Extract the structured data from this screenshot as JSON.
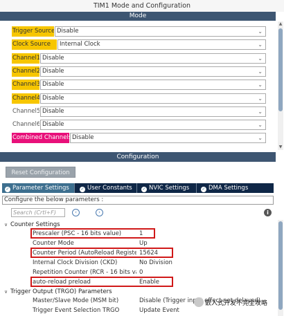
{
  "window": {
    "title": "TIM1 Mode and Configuration"
  },
  "mode_header": "Mode",
  "mode_rows": [
    {
      "label": "Trigger Source",
      "value": "Disable",
      "highlight": "#f7c600"
    },
    {
      "label": "Clock Source",
      "value": "Internal Clock",
      "highlight": "#f7c600"
    },
    {
      "label": "Channel1",
      "value": "Disable",
      "highlight": "#f7c600"
    },
    {
      "label": "Channel2",
      "value": "Disable",
      "highlight": "#f7c600"
    },
    {
      "label": "Channel3",
      "value": "Disable",
      "highlight": "#f7c600"
    },
    {
      "label": "Channel4",
      "value": "Disable",
      "highlight": "#f7c600"
    },
    {
      "label": "Channel5",
      "value": "Disable",
      "highlight": ""
    },
    {
      "label": "Channel6",
      "value": "Disable",
      "highlight": ""
    },
    {
      "label": "Combined Channels",
      "value": "Disable",
      "highlight": "#e8107a"
    }
  ],
  "config_header": "Configuration",
  "reset_button": "Reset Configuration",
  "tabs": [
    {
      "label": "Parameter Settings",
      "active": true
    },
    {
      "label": "User Constants",
      "active": false
    },
    {
      "label": "NVIC Settings",
      "active": false
    },
    {
      "label": "DMA Settings",
      "active": false
    }
  ],
  "config_hint": "Configure the below parameters :",
  "search": {
    "placeholder": "Search (Crtl+F)"
  },
  "groups": {
    "counter": "Counter Settings",
    "trgo": "Trigger Output (TRGO) Parameters"
  },
  "params": [
    {
      "name": "Prescaler (PSC - 16 bits value)",
      "value": "1"
    },
    {
      "name": "Counter Mode",
      "value": "Up"
    },
    {
      "name": "Counter Period (AutoReload Registe...",
      "value": "15624"
    },
    {
      "name": "Internal Clock Division (CKD)",
      "value": "No Division"
    },
    {
      "name": "Repetition Counter (RCR - 16 bits va...",
      "value": "0"
    },
    {
      "name": "auto-reload preload",
      "value": "Enable"
    },
    {
      "name": "Master/Slave Mode (MSM bit)",
      "value": "Disable (Trigger input effect not delayed)"
    },
    {
      "name": "Trigger Event Selection TRGO",
      "value": "Update Event"
    }
  ],
  "watermark": "嵌入式开发不完全攻略",
  "colors": {
    "section_bar": "#3e5672",
    "tab_bar": "#0f2747",
    "active_tab": "#3d6f8f",
    "highlight_yellow": "#f7c600",
    "highlight_magenta": "#e8107a",
    "annotation_red": "#d01818"
  }
}
